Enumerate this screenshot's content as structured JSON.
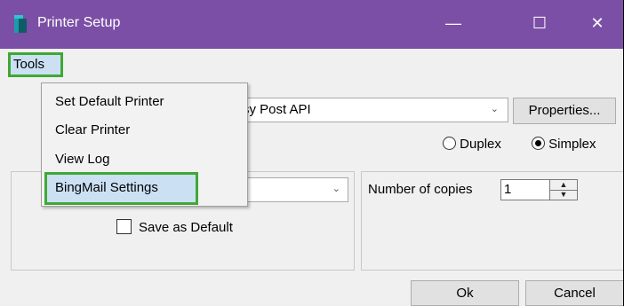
{
  "window": {
    "title": "Printer Setup",
    "minimize_glyph": "—",
    "maximize_glyph": "☐",
    "close_glyph": "✕"
  },
  "menubar": {
    "tools_label": "Tools"
  },
  "tools_menu": {
    "items": [
      "Set Default Printer",
      "Clear Printer",
      "View Log",
      "BingMail Settings"
    ]
  },
  "printer": {
    "selected_visible": "sy Post API",
    "properties_label": "Properties..."
  },
  "print_mode": {
    "duplex_label": "Duplex",
    "simplex_label": "Simplex",
    "selected": "Simplex"
  },
  "options": {
    "save_default_label": "Save as Default",
    "save_default_checked": false
  },
  "copies": {
    "label": "Number of copies",
    "value": "1"
  },
  "buttons": {
    "ok_label": "Ok",
    "cancel_label": "Cancel"
  },
  "colors": {
    "titlebar": "#7b4fa6",
    "highlight_border": "#3fa835",
    "menu_selected_bg": "#cce0f4"
  },
  "icons": {
    "app": "printer-app-icon",
    "dropdown": "chevron-down-icon",
    "spinner_up": "spin-up-icon",
    "spinner_down": "spin-down-icon"
  }
}
